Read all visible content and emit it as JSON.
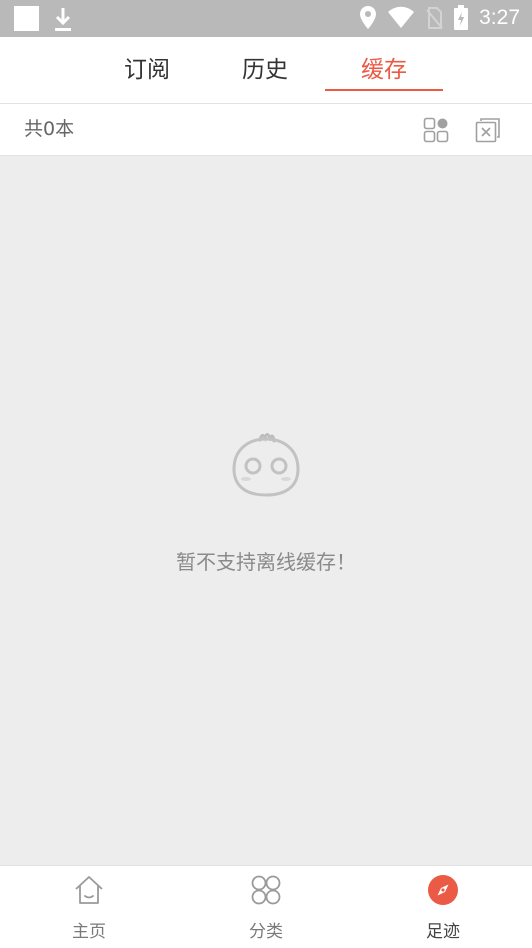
{
  "status_bar": {
    "time": "3:27"
  },
  "tabs": [
    {
      "label": "订阅",
      "active": false
    },
    {
      "label": "历史",
      "active": false
    },
    {
      "label": "缓存",
      "active": true
    }
  ],
  "toolbar": {
    "count_text": "共0本"
  },
  "empty_state": {
    "message": "暂不支持离线缓存！"
  },
  "bottom_nav": [
    {
      "label": "主页",
      "icon": "home-icon",
      "active": false
    },
    {
      "label": "分类",
      "icon": "category-icon",
      "active": false
    },
    {
      "label": "足迹",
      "icon": "compass-icon",
      "active": true
    }
  ],
  "colors": {
    "accent": "#ea5a45",
    "background": "#ededed",
    "status_bar": "#b9b9b9"
  }
}
